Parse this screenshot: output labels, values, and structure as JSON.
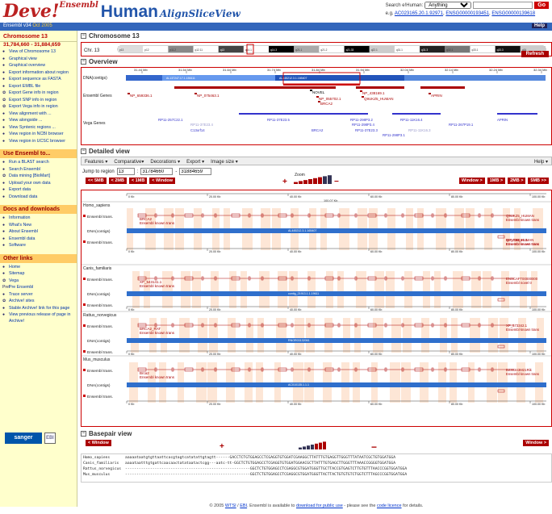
{
  "header": {
    "logo_main": "Deve!",
    "logo_super": "Ensembl",
    "species": "Human",
    "view": "AlignSliceView",
    "search_label": "Search e!Human:",
    "search_select": "Anything",
    "go": "Go",
    "eg_prefix": "e.g.",
    "eg_links": [
      "AC023165.20.1.92971",
      "ENSG00000193451",
      "ENSG00000139618"
    ]
  },
  "topbar": {
    "release": "Ensembl v34",
    "date": "Oct 2005",
    "help": "Help"
  },
  "sidebar": {
    "title": "Chromosome 13",
    "location": "31,784,660 - 31,884,659",
    "links": [
      {
        "icon": "●",
        "label": "View of Chromosome 13"
      },
      {
        "icon": "●",
        "label": "Graphical view"
      },
      {
        "icon": "●",
        "label": "Graphical overview"
      },
      {
        "icon": "●",
        "label": "Export information about region"
      },
      {
        "icon": "●",
        "label": "Export sequence as FASTA"
      },
      {
        "icon": "●",
        "label": "Export EMBL file"
      },
      {
        "icon": "✿",
        "label": "Export Gene info in region"
      },
      {
        "icon": "✿",
        "label": "Export SNP info in region"
      },
      {
        "icon": "✿",
        "label": "Export Vega info in region"
      },
      {
        "icon": "●",
        "label": "View alignment with ..."
      },
      {
        "icon": "●",
        "label": "View alongside ..."
      },
      {
        "icon": "●",
        "label": "View Syntenic regions ..."
      },
      {
        "icon": "●",
        "label": "View region in NCBI browser"
      },
      {
        "icon": "●",
        "label": "View region in UCSC browser"
      }
    ],
    "use_title": "Use Ensembl to...",
    "use_links": [
      {
        "icon": "●",
        "label": "Run a BLAST search"
      },
      {
        "icon": "●",
        "label": "Search Ensembl"
      },
      {
        "icon": "✿",
        "label": "Data mining [BioMart]"
      },
      {
        "icon": "●",
        "label": "Upload your own data"
      },
      {
        "icon": "●",
        "label": "Export data"
      },
      {
        "icon": "●",
        "label": "Download data"
      }
    ],
    "docs_title": "Docs and downloads",
    "docs_links": [
      {
        "icon": "●",
        "label": "Information"
      },
      {
        "icon": "●",
        "label": "What's New"
      },
      {
        "icon": "●",
        "label": "About Ensembl"
      },
      {
        "icon": "●",
        "label": "Ensembl data"
      },
      {
        "icon": "●",
        "label": "Software"
      }
    ],
    "other_title": "Other links",
    "other_links": [
      {
        "icon": "●",
        "label": "Home"
      },
      {
        "icon": "●",
        "label": "Sitemap"
      },
      {
        "icon": "✿",
        "label": "Vega"
      },
      {
        "icon": "Pre!",
        "label": "Pre Ensembl"
      },
      {
        "icon": "●",
        "label": "Trace server"
      },
      {
        "icon": "✿",
        "label": "Archive! sites"
      },
      {
        "icon": "●",
        "label": "Stable Archive! link for this page"
      },
      {
        "icon": "●",
        "label": "View previous release of page in Archive!"
      }
    ],
    "sanger": "sanger",
    "ebi": "EBI"
  },
  "chromosome": {
    "title": "Chromosome 13",
    "label": "Chr. 13",
    "bands": [
      "p13",
      "p12",
      "p11.2",
      "q12.11",
      "q13",
      "q14.1",
      "q14.3",
      "q21.1",
      "q21.2",
      "q21.33",
      "q22.1",
      "q31.1",
      "q31.3",
      "q32.1",
      "q33.1",
      "q33.3",
      "q34"
    ]
  },
  "overview": {
    "title": "Overview",
    "tracks": [
      "DNA(contigs)",
      "Ensembl Genes",
      "Vega Genes"
    ],
    "ticks": [
      "31.44 Mb",
      "31.54 Mb",
      "31.64 Mb",
      "31.74 Mb",
      "31.84 Mb",
      "31.94 Mb",
      "32.04 Mb",
      "32.14 Mb",
      "32.24 Mb",
      "32.34 Mb"
    ],
    "contigs": [
      "AL137247.17.1.156111",
      "AL445212.3.1.165407"
    ],
    "genes": [
      "NP_659336.1",
      "NP_075463.1",
      "NOVEL",
      "NP_055702.1",
      "BRCA2",
      "NP_438169.1",
      "Q9UKZ5_HUMAN",
      "APRIN"
    ],
    "vega": [
      "RP11-257C22.1",
      "RP11-37E23.4",
      "C13orf14",
      "RP11-37E23.5",
      "BRCA2",
      "RP11-298P3.2",
      "RP11-298P3.4",
      "RP11-37E23.3",
      "RP11-298P3.1",
      "RP11-11K16.4",
      "RP11-11K16.3",
      "RP11-267P19.1",
      "APRIN"
    ]
  },
  "detailed": {
    "title": "Detailed view",
    "menu": [
      "Features ▾",
      "Comparative▾",
      "Decorations ▾",
      "Export ▾",
      "Image size ▾"
    ],
    "help": "Help ▾",
    "jump_label": "Jump to region",
    "jump_chr": "13",
    "jump_start": "31784660",
    "jump_end": "31884659",
    "refresh": "Refresh",
    "zoom": "Zoom",
    "nav_left": [
      "<< 5MB",
      "< 2MB",
      "< 1MB",
      "< Window"
    ],
    "nav_right": [
      "Window >",
      "1MB >",
      "2MB >",
      "5MB >>"
    ],
    "ticks": [
      "0 Kb",
      "20.00 Kb",
      "40.00 Kb",
      "60.00 Kb",
      "80.00 Kb",
      "100.00 Kb"
    ],
    "ruler_label": "100.07 Kb",
    "species": [
      {
        "name": "Homo_sapiens",
        "tracks": [
          "Ensembl trans.",
          "DNA(contigs)",
          "Ensembl trans."
        ],
        "left_labels": [
          "BRCA2",
          "Ensembl known trans"
        ],
        "right_labels": [
          "Q9UKZ5_HUMAN",
          "Ensembl known trans",
          "NP_438169.1",
          "Ensembl known trans",
          "Q9NT83_HUMAN",
          "Ensembl known trans"
        ],
        "contig": "AL445212.3.1.165407"
      },
      {
        "name": "Canis_familiaris",
        "tracks": [
          "Ensembl trans.",
          "DNA(contigs)",
          "Ensembl trans."
        ],
        "left_labels": [
          "XP_543141.1",
          "Ensembl known trans"
        ],
        "right_labels": [
          "ENSCAFT00000000",
          "Ensembl novel tr"
        ],
        "contig": "contig_21913.1.1.19611"
      },
      {
        "name": "Rattus_norvegicus",
        "tracks": [
          "Ensembl trans.",
          "DNA(contigs)",
          "Ensembl trans."
        ],
        "left_labels": [
          "BRCA2_RAT",
          "Ensembl known trans"
        ],
        "right_labels": [
          "XP_573342.1",
          "Ensembl known trans"
        ],
        "contig": "RNOR03132061"
      },
      {
        "name": "Mus_musculus",
        "tracks": [
          "Ensembl trans.",
          "DNA(contigs)",
          "Ensembl trans."
        ],
        "left_labels": [
          "Brca2",
          "Ensembl known trans"
        ],
        "right_labels": [
          "B230343M21Rik",
          "Ensembl known trans"
        ],
        "contig": "AC010135.1.1.1"
      }
    ]
  },
  "basepair": {
    "title": "Basepair view",
    "left": "< Window",
    "right": "Window >",
    "rows": [
      {
        "name": "Homo_sapiens",
        "seq": "aaaaataatgtgttaattcacgtagtcatatattgtagtt------GACCTCTGTGGAGCCTCGAGGTGTGGATCGAAGGCTTATTTGTGAGGTTGGGTTTATAATCGCTGTGGATGGA"
      },
      {
        "name": "Canis_familiaris",
        "seq": "aaaataatttgtgattcaacaactatataatactcgg---aatc-tt-GGCTCTGTGGAGCCTCGAGGTGTGGATGGAACGCTTATTTGTGAGCTTGGGTTTAAACCGGGGTGGATGGA"
      },
      {
        "name": "Rattus_norvegicus",
        "seq": "-------------------------------------------------------GGCTCTGTGGAGCCTCGAGGCGTGGATGGGTTGCTTACCGTGAGTCTTGTGTTTAACCCGGTGGATGGA"
      },
      {
        "name": "Mus_musculus",
        "seq": "-------------------------------------------------------GGCTCTGTGGAGCCTCGAGGCGTGGATGGGTTACTTACTGTGTGTCTGGTCTTTAGCCCGGTGGATGGA"
      }
    ]
  },
  "footer": {
    "prefix": "© 2005",
    "wtsi": "WTSI",
    "sep": " / ",
    "ebi": "EBI",
    "mid": ". Ensembl is available to",
    "download": "download for public use",
    "mid2": "- please see the",
    "licence": "code licence",
    "end": "for details."
  }
}
